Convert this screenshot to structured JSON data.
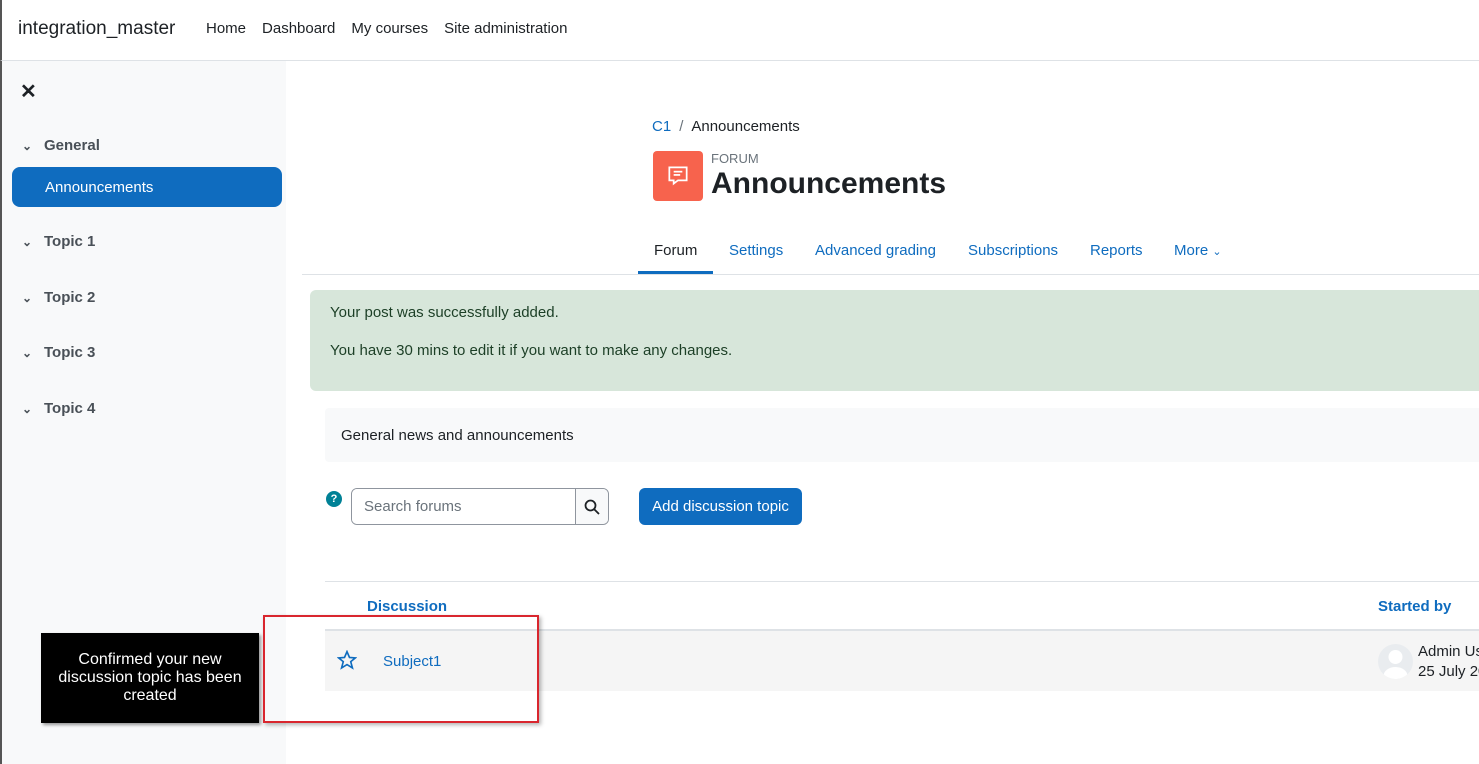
{
  "header": {
    "brand": "integration_master",
    "nav": [
      "Home",
      "Dashboard",
      "My courses",
      "Site administration"
    ]
  },
  "drawer": {
    "close_icon": "close-icon",
    "sections": [
      "General",
      "Topic 1",
      "Topic 2",
      "Topic 3",
      "Topic 4"
    ],
    "active_item": "Announcements"
  },
  "breadcrumb": {
    "course": "C1",
    "separator": "/",
    "page": "Announcements"
  },
  "activity": {
    "type_label": "FORUM",
    "title": "Announcements",
    "icon": "forum-icon",
    "icon_color": "#f7634d"
  },
  "tabs": [
    "Forum",
    "Settings",
    "Advanced grading",
    "Subscriptions",
    "Reports",
    "More"
  ],
  "alert": {
    "line1": "Your post was successfully added.",
    "line2": "You have 30 mins to edit it if you want to make any changes."
  },
  "intro": "General news and announcements",
  "search": {
    "placeholder": "Search forums",
    "help_icon": "?"
  },
  "add_button": "Add discussion topic",
  "table": {
    "columns": [
      "Discussion",
      "Started by"
    ],
    "rows": [
      {
        "subject": "Subject1",
        "author": "Admin Us",
        "date": "25 July 20"
      }
    ]
  },
  "annotation": {
    "tooltip": "Confirmed your new discussion topic has been created"
  },
  "colors": {
    "primary": "#0f6cbf",
    "alert_bg": "#d7e6da",
    "highlight": "#d9262e"
  }
}
